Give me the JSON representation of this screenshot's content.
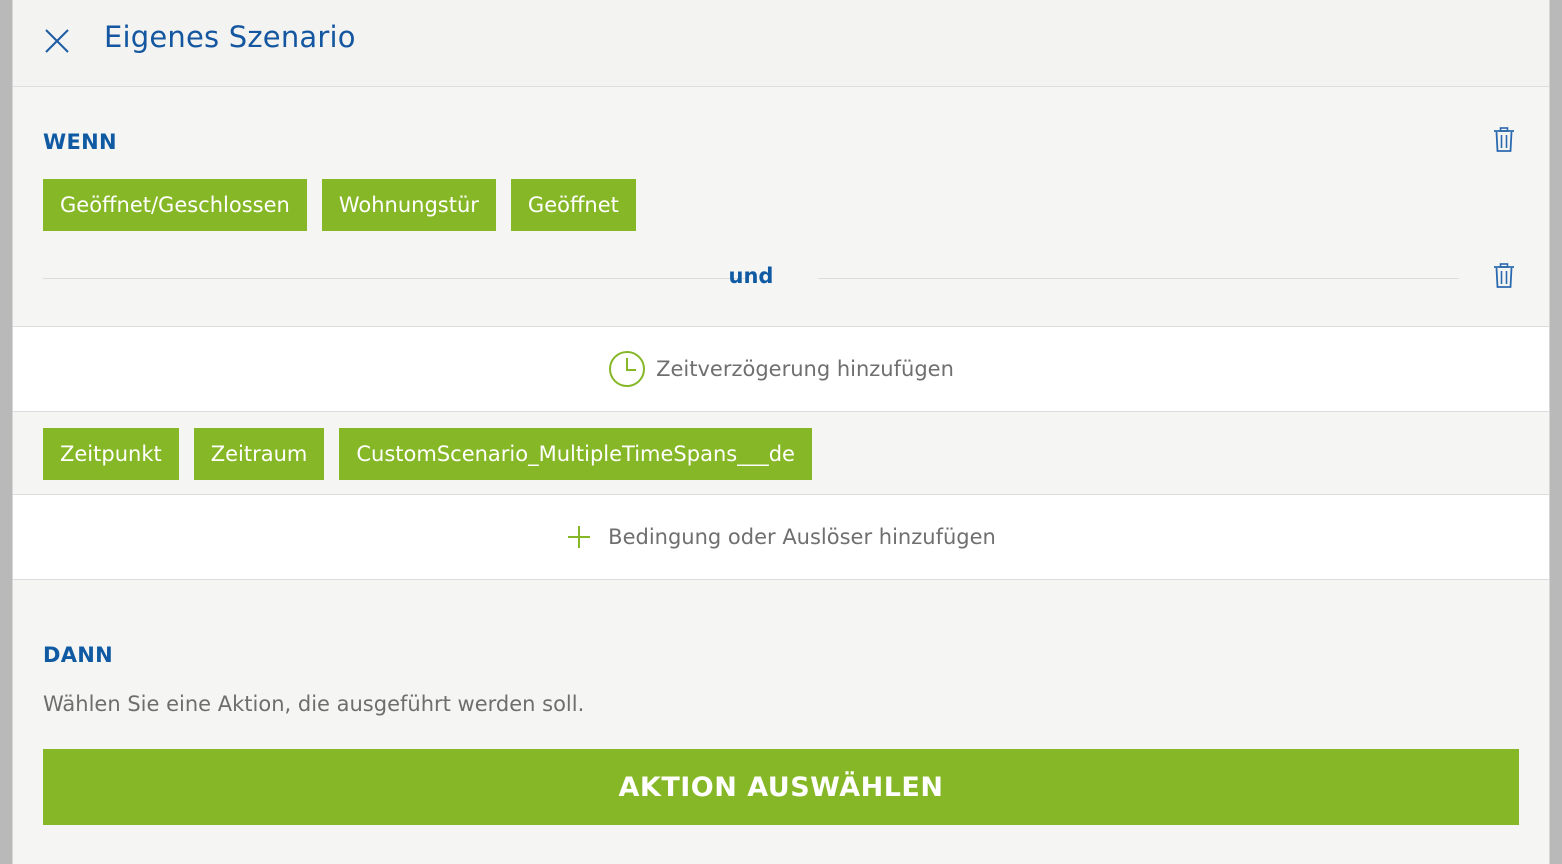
{
  "header": {
    "title": "Eigenes Szenario",
    "close_icon": "close-icon"
  },
  "wenn": {
    "label": "WENN",
    "chips": [
      "Geöffnet/Geschlossen",
      "Wohnungstür",
      "Geöffnet"
    ],
    "connector": "und",
    "delay_label": "Zeitverzögerung hinzufügen",
    "time_chips": [
      "Zeitpunkt",
      "Zeitraum",
      "CustomScenario_MultipleTimeSpans___de"
    ],
    "add_condition_label": "Bedingung oder Auslöser hinzufügen"
  },
  "dann": {
    "label": "DANN",
    "hint": "Wählen Sie eine Aktion, die ausgeführt werden soll.",
    "action_button": "AKTION AUSWÄHLEN"
  },
  "colors": {
    "accent_green": "#86b726",
    "brand_blue": "#1457a0"
  }
}
